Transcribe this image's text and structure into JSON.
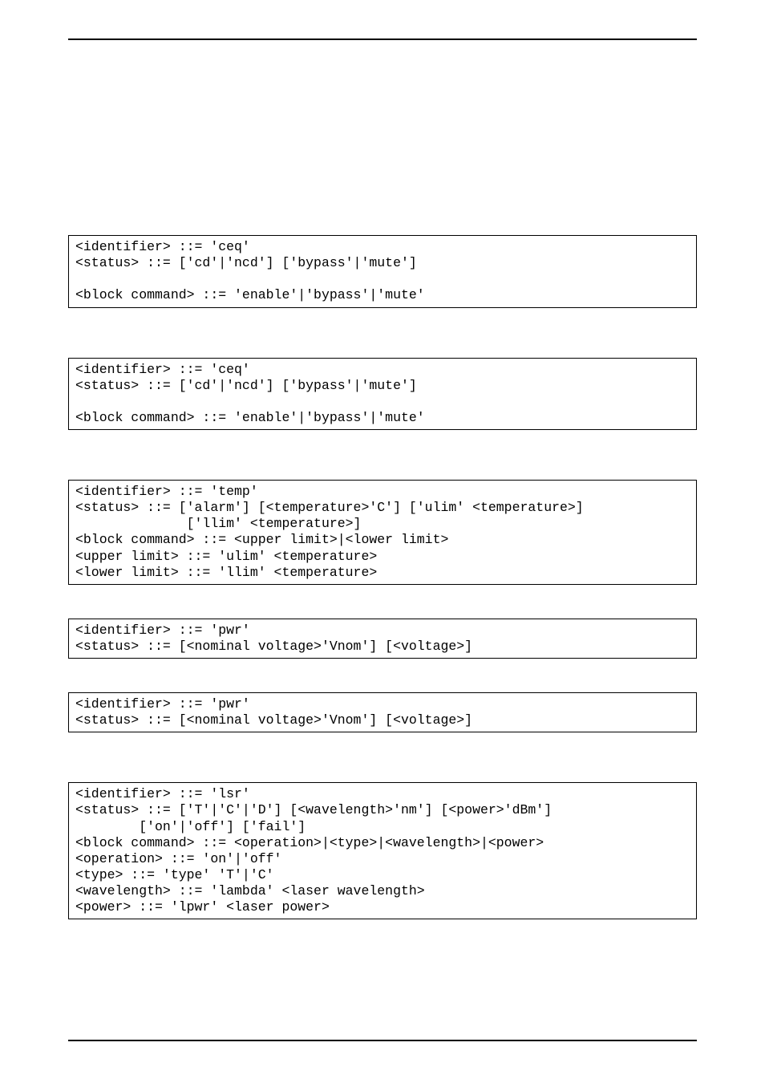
{
  "blocks": {
    "ceq1": {
      "line1": "<identifier> ::= 'ceq'",
      "line2": "<status> ::= ['cd'|'ncd'] ['bypass'|'mute']",
      "line3": "",
      "line4": "<block command> ::= 'enable'|'bypass'|'mute'"
    },
    "ceq2": {
      "line1": "<identifier> ::= 'ceq'",
      "line2": "<status> ::= ['cd'|'ncd'] ['bypass'|'mute']",
      "line3": "",
      "line4": "<block command> ::= 'enable'|'bypass'|'mute'"
    },
    "temp": {
      "line1": "<identifier> ::= 'temp'",
      "line2": "<status> ::= ['alarm'] [<temperature>'C'] ['ulim' <temperature>]",
      "line3": "              ['llim' <temperature>]",
      "line4": "<block command> ::= <upper limit>|<lower limit>",
      "line5": "<upper limit> ::= 'ulim' <temperature>",
      "line6": "<lower limit> ::= 'llim' <temperature>"
    },
    "pwr1": {
      "line1": "<identifier> ::= 'pwr'",
      "line2": "<status> ::= [<nominal voltage>'Vnom'] [<voltage>]"
    },
    "pwr2": {
      "line1": "<identifier> ::= 'pwr'",
      "line2": "<status> ::= [<nominal voltage>'Vnom'] [<voltage>]"
    },
    "lsr": {
      "line1": "<identifier> ::= 'lsr'",
      "line2": "<status> ::= ['T'|'C'|'D'] [<wavelength>'nm'] [<power>'dBm']",
      "line3": "        ['on'|'off'] ['fail']",
      "line4": "<block command> ::= <operation>|<type>|<wavelength>|<power>",
      "line5": "<operation> ::= 'on'|'off'",
      "line6": "<type> ::= 'type' 'T'|'C'",
      "line7": "<wavelength> ::= 'lambda' <laser wavelength>",
      "line8": "<power> ::= 'lpwr' <laser power>"
    }
  }
}
